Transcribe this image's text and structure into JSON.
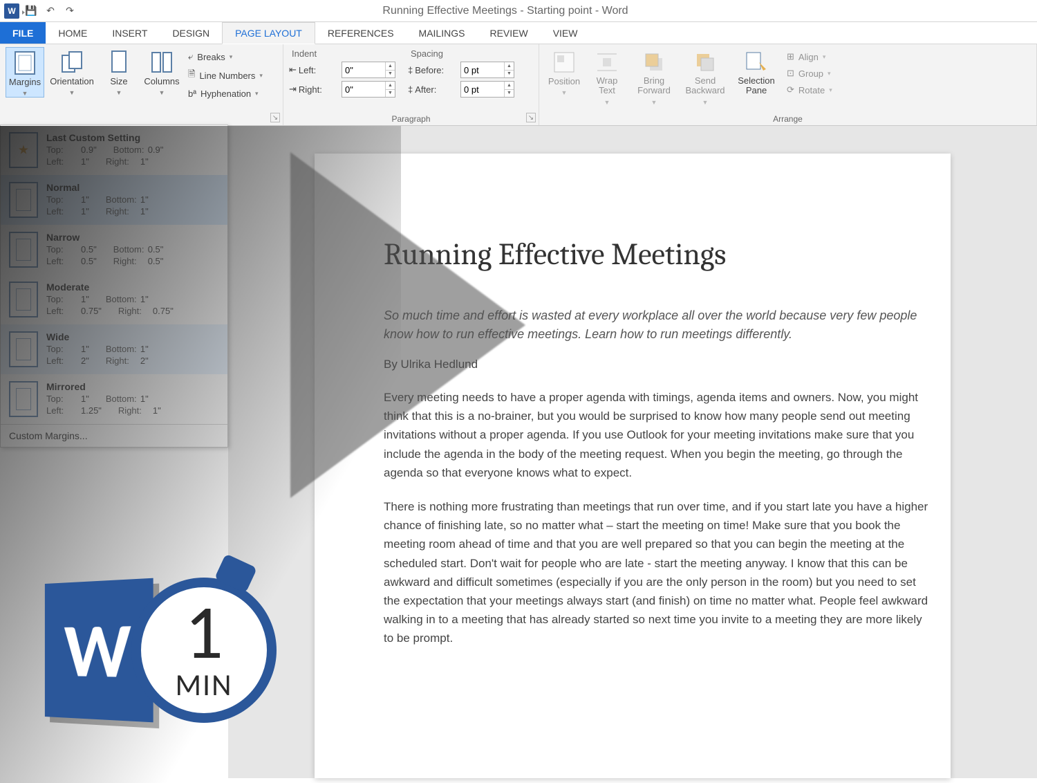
{
  "titlebar": {
    "doc_title": "Running Effective Meetings - Starting point - Word"
  },
  "tabs": {
    "file": "FILE",
    "home": "HOME",
    "insert": "INSERT",
    "design": "DESIGN",
    "page_layout": "PAGE LAYOUT",
    "references": "REFERENCES",
    "mailings": "MAILINGS",
    "review": "REVIEW",
    "view": "VIEW"
  },
  "ribbon": {
    "page_setup": {
      "margins": "Margins",
      "orientation": "Orientation",
      "size": "Size",
      "columns": "Columns",
      "breaks": "Breaks",
      "line_numbers": "Line Numbers",
      "hyphenation": "Hyphenation"
    },
    "paragraph": {
      "label": "Paragraph",
      "indent_label": "Indent",
      "spacing_label": "Spacing",
      "left_label": "Left:",
      "right_label": "Right:",
      "before_label": "Before:",
      "after_label": "After:",
      "left_val": "0\"",
      "right_val": "0\"",
      "before_val": "0 pt",
      "after_val": "0 pt"
    },
    "arrange": {
      "label": "Arrange",
      "position": "Position",
      "wrap": "Wrap Text",
      "bring": "Bring Forward",
      "send": "Send Backward",
      "selpane": "Selection Pane",
      "align": "Align",
      "group": "Group",
      "rotate": "Rotate"
    }
  },
  "margins_menu": {
    "items": [
      {
        "name": "Last Custom Setting",
        "top": "0.9\"",
        "bottom": "0.9\"",
        "left": "1\"",
        "right": "1\"",
        "star": true
      },
      {
        "name": "Normal",
        "top": "1\"",
        "bottom": "1\"",
        "left": "1\"",
        "right": "1\""
      },
      {
        "name": "Narrow",
        "top": "0.5\"",
        "bottom": "0.5\"",
        "left": "0.5\"",
        "right": "0.5\""
      },
      {
        "name": "Moderate",
        "top": "1\"",
        "bottom": "1\"",
        "left": "0.75\"",
        "right": "0.75\""
      },
      {
        "name": "Wide",
        "top": "1\"",
        "bottom": "1\"",
        "left": "2\"",
        "right": "2\""
      },
      {
        "name": "Mirrored",
        "top": "1\"",
        "bottom": "1\"",
        "left": "1.25\"",
        "right": "1\""
      }
    ],
    "labels": {
      "top": "Top:",
      "bottom": "Bottom:",
      "left": "Left:",
      "right": "Right:"
    },
    "custom": "Custom Margins..."
  },
  "document": {
    "title": "Running Effective Meetings",
    "intro": "So much time and effort is wasted at every workplace all over the world because very few people know how to run effective meetings. Learn how to run meetings differently.",
    "byline": "By Ulrika Hedlund",
    "para1": "Every meeting needs to have a proper agenda with timings, agenda items and owners. Now, you might think that this is a no-brainer, but you would be surprised to know how many people send out meeting invitations without a proper agenda. If you use Outlook for your meeting invitations make sure that you include the agenda in the body of the meeting request. When you begin the meeting, go through the agenda so that everyone knows what to expect.",
    "para2": "There is nothing more frustrating than meetings that run over time, and if you start late you have a higher chance of finishing late, so no matter what – start the meeting on time! Make sure that you book the meeting room ahead of time and that you are well prepared so that you can begin the meeting at the scheduled start. Don't wait for people who are late - start the meeting anyway. I know that this can be awkward and difficult sometimes (especially if you are the only person in the room) but you need to set the expectation that your meetings always start (and finish) on time no matter what. People feel awkward walking in to a meeting that has already started so next time you invite to a meeting they are more likely to be prompt."
  },
  "badge": {
    "letter": "W",
    "num": "1",
    "unit": "MIN"
  }
}
